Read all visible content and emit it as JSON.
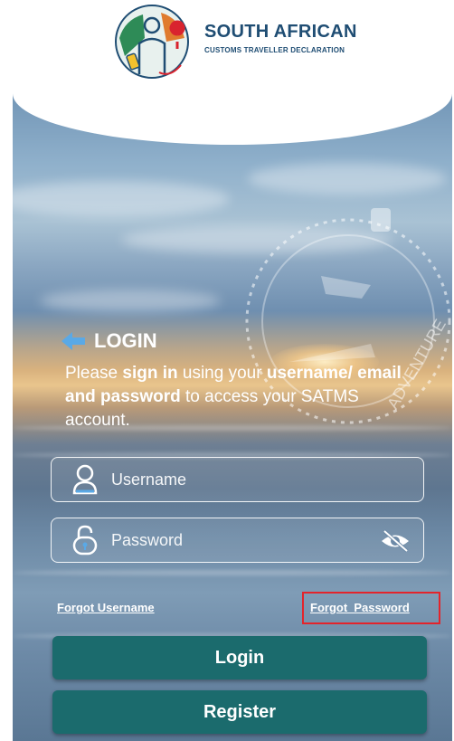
{
  "brand": {
    "title": "SOUTH AFRICAN",
    "subtitle": "CUSTOMS TRAVELLER DECLARATION"
  },
  "login": {
    "title": "LOGIN",
    "intro_pre": "Please ",
    "intro_b1": "sign in",
    "intro_mid": " using your ",
    "intro_b2": "username/ email and password",
    "intro_post": " to access your SATMS account."
  },
  "fields": {
    "username_placeholder": "Username",
    "password_placeholder": "Password"
  },
  "links": {
    "forgot_username": "Forgot Username",
    "forgot_password": "Forgot  Password"
  },
  "buttons": {
    "login": "Login",
    "register": "Register"
  },
  "stamp_text": "ADVENTURE",
  "colors": {
    "brand_navy": "#1f4d73",
    "button_teal": "#1b6b6d",
    "highlight_red": "#e3242b",
    "arrow_blue": "#5aa9e6"
  },
  "icons": {
    "back": "back-arrow-icon",
    "user": "user-icon",
    "lock": "padlock-icon",
    "visibility": "eye-off-icon"
  }
}
